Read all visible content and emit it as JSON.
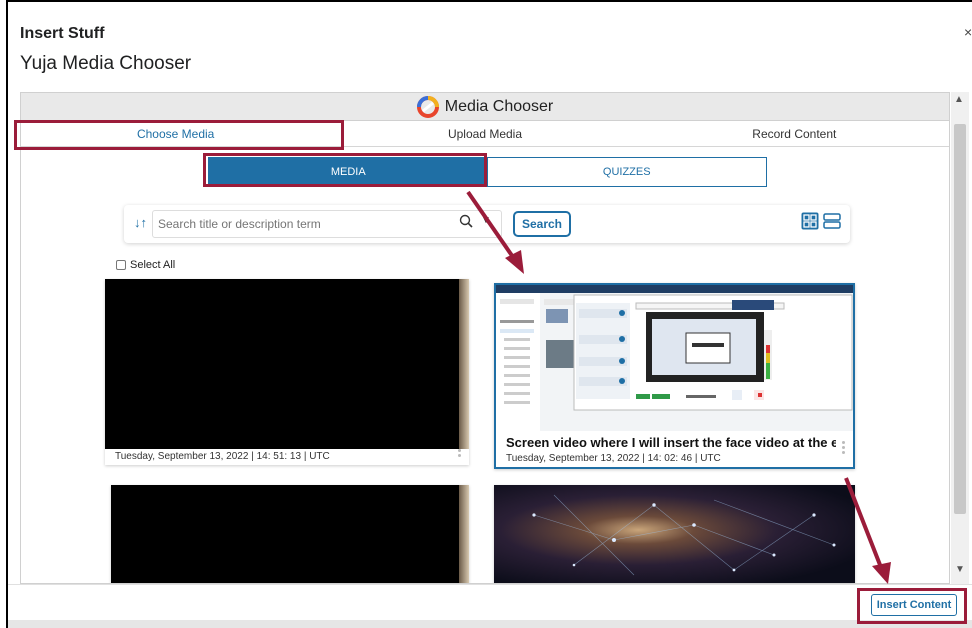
{
  "dialog": {
    "title": "Insert Stuff",
    "close": "×",
    "subtitle": "Yuja Media Chooser"
  },
  "chooser": {
    "header": "Media Chooser",
    "tabs": [
      {
        "label": "Choose Media",
        "active": true
      },
      {
        "label": "Upload Media",
        "active": false
      },
      {
        "label": "Record Content",
        "active": false
      }
    ],
    "segments": [
      {
        "label": "MEDIA",
        "active": true
      },
      {
        "label": "QUIZZES",
        "active": false
      }
    ],
    "search": {
      "placeholder": "Search title or description term",
      "button": "Search",
      "sort_icon": "sort-icon",
      "glass_icon": "search-icon",
      "grid_icon": "grid-view-icon",
      "list_icon": "list-view-icon"
    },
    "select_all": "Select All",
    "media": [
      {
        "title": "",
        "date": "Tuesday, September 13, 2022 | 14: 51: 13 | UTC"
      },
      {
        "title": "Screen video where I will insert the face video at the en",
        "date": "Tuesday, September 13, 2022 | 14: 02: 46 | UTC"
      },
      {
        "title": "",
        "date": ""
      },
      {
        "title": "",
        "date": ""
      }
    ]
  },
  "footer": {
    "insert_button": "Insert Content"
  },
  "colors": {
    "accent": "#1f6fa5",
    "highlight": "#9b1c3a"
  }
}
